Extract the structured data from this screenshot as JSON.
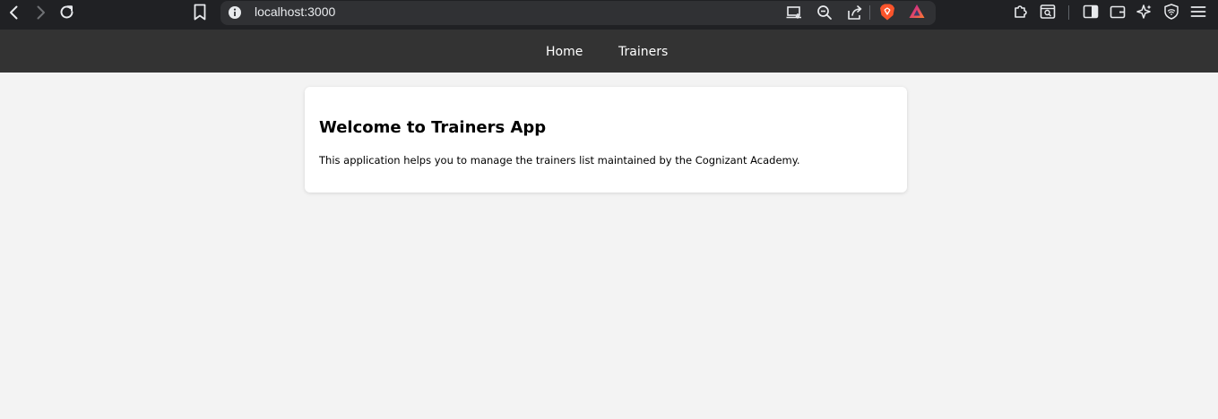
{
  "browser": {
    "url": "localhost:3000",
    "icons": {
      "back": "back-arrow-icon",
      "forward": "forward-arrow-icon",
      "reload": "reload-icon",
      "bookmark": "bookmark-icon",
      "site_info": "info-icon",
      "install": "install-app-icon",
      "zoom": "zoom-out-icon",
      "share": "share-icon",
      "brave_shields": "brave-shields-icon",
      "brave_rewards": "brave-rewards-icon",
      "extensions": "extensions-icon",
      "search_page": "search-page-icon",
      "sidebar": "sidebar-icon",
      "wallet": "wallet-icon",
      "leo": "leo-ai-icon",
      "vpn": "vpn-icon",
      "menu": "menu-icon"
    }
  },
  "navbar": {
    "links": [
      {
        "label": "Home"
      },
      {
        "label": "Trainers"
      }
    ]
  },
  "card": {
    "title": "Welcome to Trainers App",
    "description": "This application helps you to manage the trainers list maintained by the Cognizant Academy."
  },
  "colors": {
    "navbar_bg": "#333333",
    "page_bg": "#f3f3f3",
    "card_bg": "#ffffff",
    "chrome_bg": "#202124",
    "brave_orange": "#fb542b"
  }
}
